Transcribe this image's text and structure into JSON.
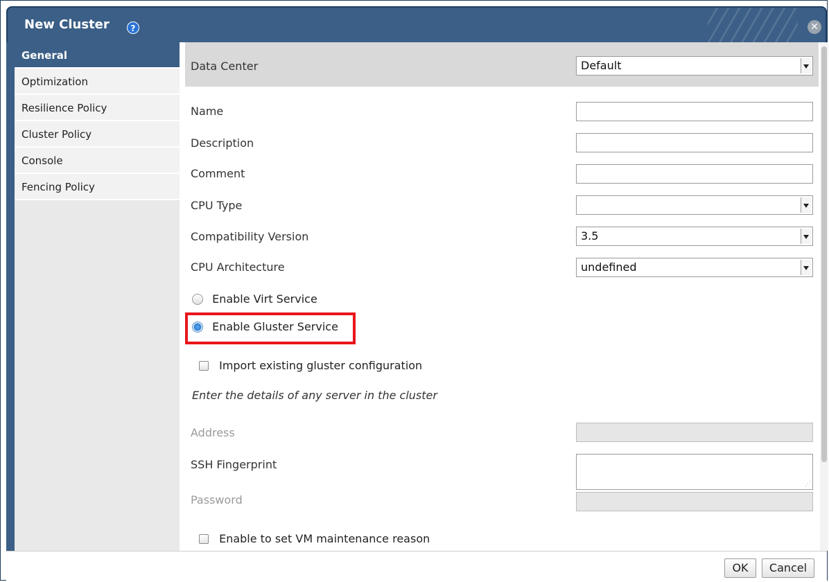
{
  "dialog": {
    "title": "New Cluster",
    "help_icon": "question-circle-icon",
    "close_icon": "close-circle-icon"
  },
  "sidebar": {
    "items": [
      {
        "label": "General",
        "active": true
      },
      {
        "label": "Optimization",
        "active": false
      },
      {
        "label": "Resilience Policy",
        "active": false
      },
      {
        "label": "Cluster Policy",
        "active": false
      },
      {
        "label": "Console",
        "active": false
      },
      {
        "label": "Fencing Policy",
        "active": false
      }
    ]
  },
  "form": {
    "data_center": {
      "label": "Data Center",
      "value": "Default"
    },
    "name": {
      "label": "Name",
      "value": ""
    },
    "description": {
      "label": "Description",
      "value": ""
    },
    "comment": {
      "label": "Comment",
      "value": ""
    },
    "cpu_type": {
      "label": "CPU Type",
      "value": ""
    },
    "compatibility_version": {
      "label": "Compatibility Version",
      "value": "3.5"
    },
    "cpu_architecture": {
      "label": "CPU Architecture",
      "value": "undefined"
    },
    "enable_virt": {
      "label": "Enable Virt Service",
      "checked": false
    },
    "enable_gluster": {
      "label": "Enable Gluster Service",
      "checked": true
    },
    "import_gluster": {
      "label": "Import existing gluster configuration",
      "checked": false
    },
    "server_note": "Enter the details of any server in the cluster",
    "address": {
      "label": "Address",
      "value": ""
    },
    "ssh_fingerprint": {
      "label": "SSH Fingerprint",
      "value": ""
    },
    "password": {
      "label": "Password",
      "value": ""
    },
    "vm_maintenance": {
      "label": "Enable to set VM maintenance reason",
      "checked": false
    }
  },
  "buttons": {
    "ok": "OK",
    "cancel": "Cancel"
  },
  "colors": {
    "title_bar": "#3b5f86",
    "highlight": "#e8161b",
    "active_nav": "#3b5f86"
  }
}
